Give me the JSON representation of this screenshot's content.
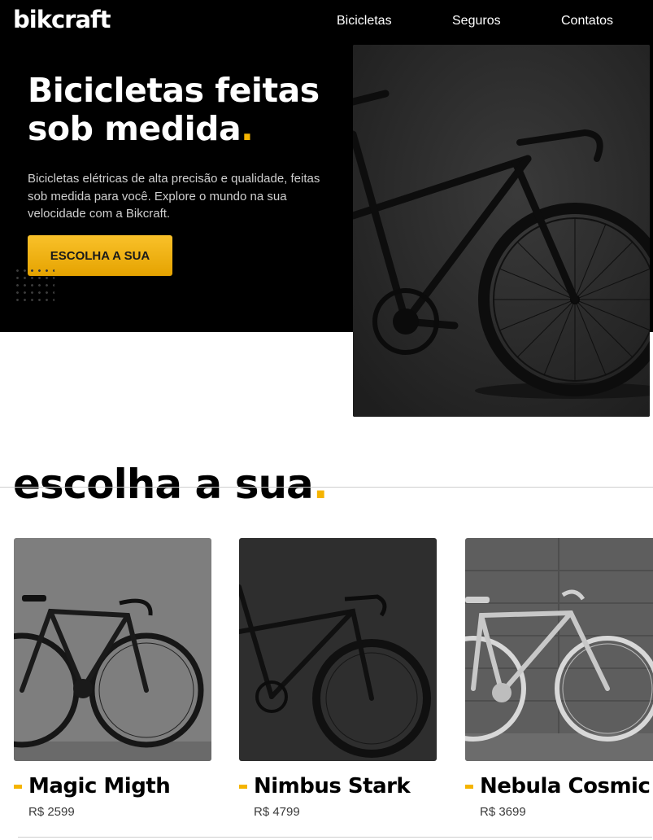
{
  "header": {
    "logo": "bikcraft",
    "nav": [
      "Bicicletas",
      "Seguros",
      "Contatos"
    ]
  },
  "hero": {
    "title_line1": "Bicicletas feitas",
    "title_line2": "sob medida",
    "title_dot": ".",
    "text": "Bicicletas elétricas de alta precisão e qualidade, feitas sob medida para você. Explore o mundo na sua velocidade com a Bikcraft.",
    "button_label": "ESCOLHA A SUA"
  },
  "products": {
    "title": "escolha a sua",
    "title_dot": ".",
    "items": [
      {
        "name": "Magic Migth",
        "price": "R$ 2599"
      },
      {
        "name": "Nimbus Stark",
        "price": "R$ 4799"
      },
      {
        "name": "Nebula Cosmic",
        "price": "R$ 3699"
      }
    ]
  },
  "colors": {
    "accent": "#f5b400",
    "hero_bg": "#000000"
  },
  "icons": [
    "bicycle-photo"
  ]
}
